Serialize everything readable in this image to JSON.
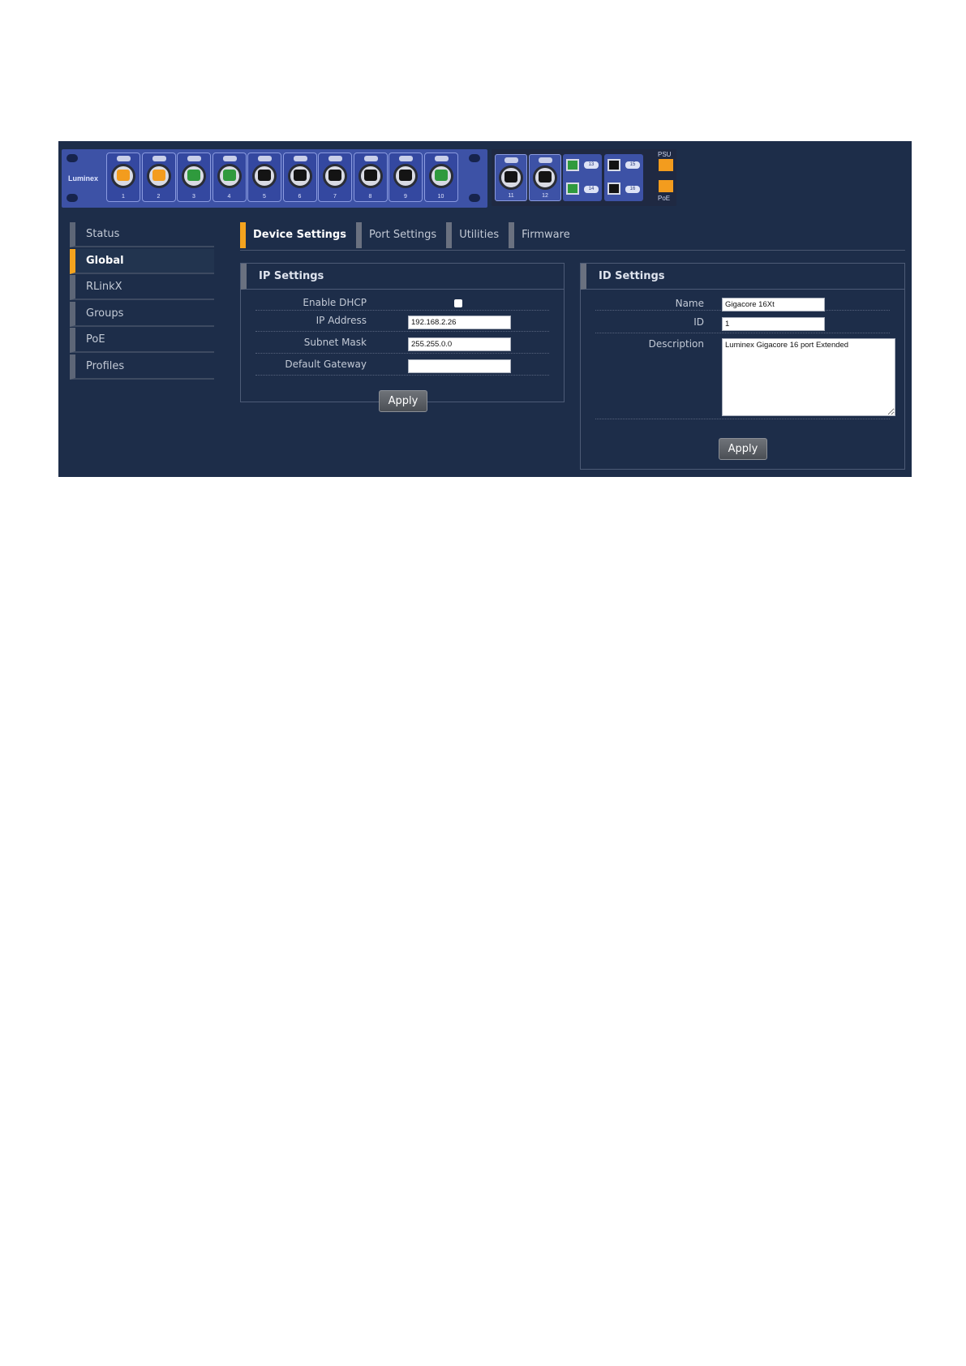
{
  "device": {
    "brand": "Luminex",
    "ports": [
      {
        "label": "1",
        "color": "orange"
      },
      {
        "label": "2",
        "color": "orange"
      },
      {
        "label": "3",
        "color": "green"
      },
      {
        "label": "4",
        "color": "green"
      },
      {
        "label": "5",
        "color": "black"
      },
      {
        "label": "6",
        "color": "black"
      },
      {
        "label": "7",
        "color": "black"
      },
      {
        "label": "8",
        "color": "black"
      },
      {
        "label": "9",
        "color": "black"
      },
      {
        "label": "10",
        "color": "green"
      }
    ],
    "ext_ports": [
      {
        "label": "11",
        "color": "black"
      },
      {
        "label": "12",
        "color": "black"
      }
    ],
    "sfp": [
      {
        "label": "13",
        "color": "green"
      },
      {
        "label": "14",
        "color": "green"
      },
      {
        "label": "15",
        "color": "black"
      },
      {
        "label": "16",
        "color": "black"
      }
    ],
    "psu_label": "PSU",
    "poe_label": "PoE",
    "indicator_color": "#f39c1e"
  },
  "sidebar": {
    "items": [
      {
        "label": "Status",
        "active": false
      },
      {
        "label": "Global",
        "active": true
      },
      {
        "label": "RLinkX",
        "active": false
      },
      {
        "label": "Groups",
        "active": false
      },
      {
        "label": "PoE",
        "active": false
      },
      {
        "label": "Profiles",
        "active": false
      }
    ]
  },
  "tabs": [
    {
      "label": "Device Settings",
      "active": true
    },
    {
      "label": "Port Settings",
      "active": false
    },
    {
      "label": "Utilities",
      "active": false
    },
    {
      "label": "Firmware",
      "active": false
    }
  ],
  "ip_settings": {
    "title": "IP Settings",
    "dhcp_label": "Enable DHCP",
    "dhcp_checked": false,
    "ip_label": "IP Address",
    "ip_value": "192.168.2.26",
    "mask_label": "Subnet Mask",
    "mask_value": "255.255.0.0",
    "gateway_label": "Default Gateway",
    "gateway_value": "",
    "apply_label": "Apply"
  },
  "id_settings": {
    "title": "ID Settings",
    "name_label": "Name",
    "name_value": "Gigacore 16Xt",
    "id_label": "ID",
    "id_value": "1",
    "description_label": "Description",
    "description_value": "Luminex Gigacore 16 port Extended",
    "apply_label": "Apply"
  },
  "colors": {
    "background": "#1d2d49",
    "accent": "#f4a31e",
    "rack": "#3d52a6"
  }
}
